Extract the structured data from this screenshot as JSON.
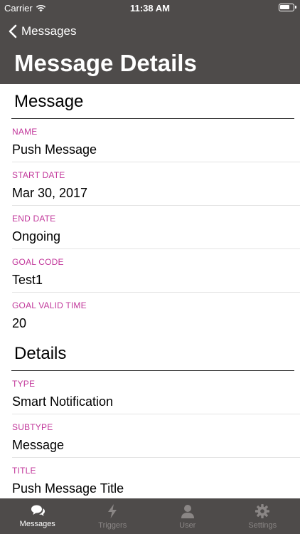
{
  "status_bar": {
    "carrier": "Carrier",
    "time": "11:38 AM"
  },
  "nav": {
    "back_label": "Messages",
    "title": "Message Details"
  },
  "sections": [
    {
      "title": "Message",
      "fields": [
        {
          "label": "NAME",
          "value": "Push Message"
        },
        {
          "label": "START DATE",
          "value": "Mar 30, 2017"
        },
        {
          "label": "END DATE",
          "value": "Ongoing"
        },
        {
          "label": "GOAL CODE",
          "value": "Test1"
        },
        {
          "label": "GOAL VALID TIME",
          "value": "20"
        }
      ]
    },
    {
      "title": "Details",
      "fields": [
        {
          "label": "TYPE",
          "value": "Smart Notification"
        },
        {
          "label": "SUBTYPE",
          "value": "Message"
        },
        {
          "label": "TITLE",
          "value": "Push Message Title"
        }
      ]
    }
  ],
  "tabbar": {
    "tabs": [
      {
        "label": "Messages",
        "icon": "speech-bubbles-icon",
        "active": true
      },
      {
        "label": "Triggers",
        "icon": "lightning-bolt-icon",
        "active": false
      },
      {
        "label": "User",
        "icon": "user-silhouette-icon",
        "active": false
      },
      {
        "label": "Settings",
        "icon": "gear-icon",
        "active": false
      }
    ]
  },
  "colors": {
    "header_bg": "#4e4b4a",
    "label_accent": "#c2389b",
    "tab_active": "#ffffff",
    "tab_inactive": "#8a8685"
  }
}
